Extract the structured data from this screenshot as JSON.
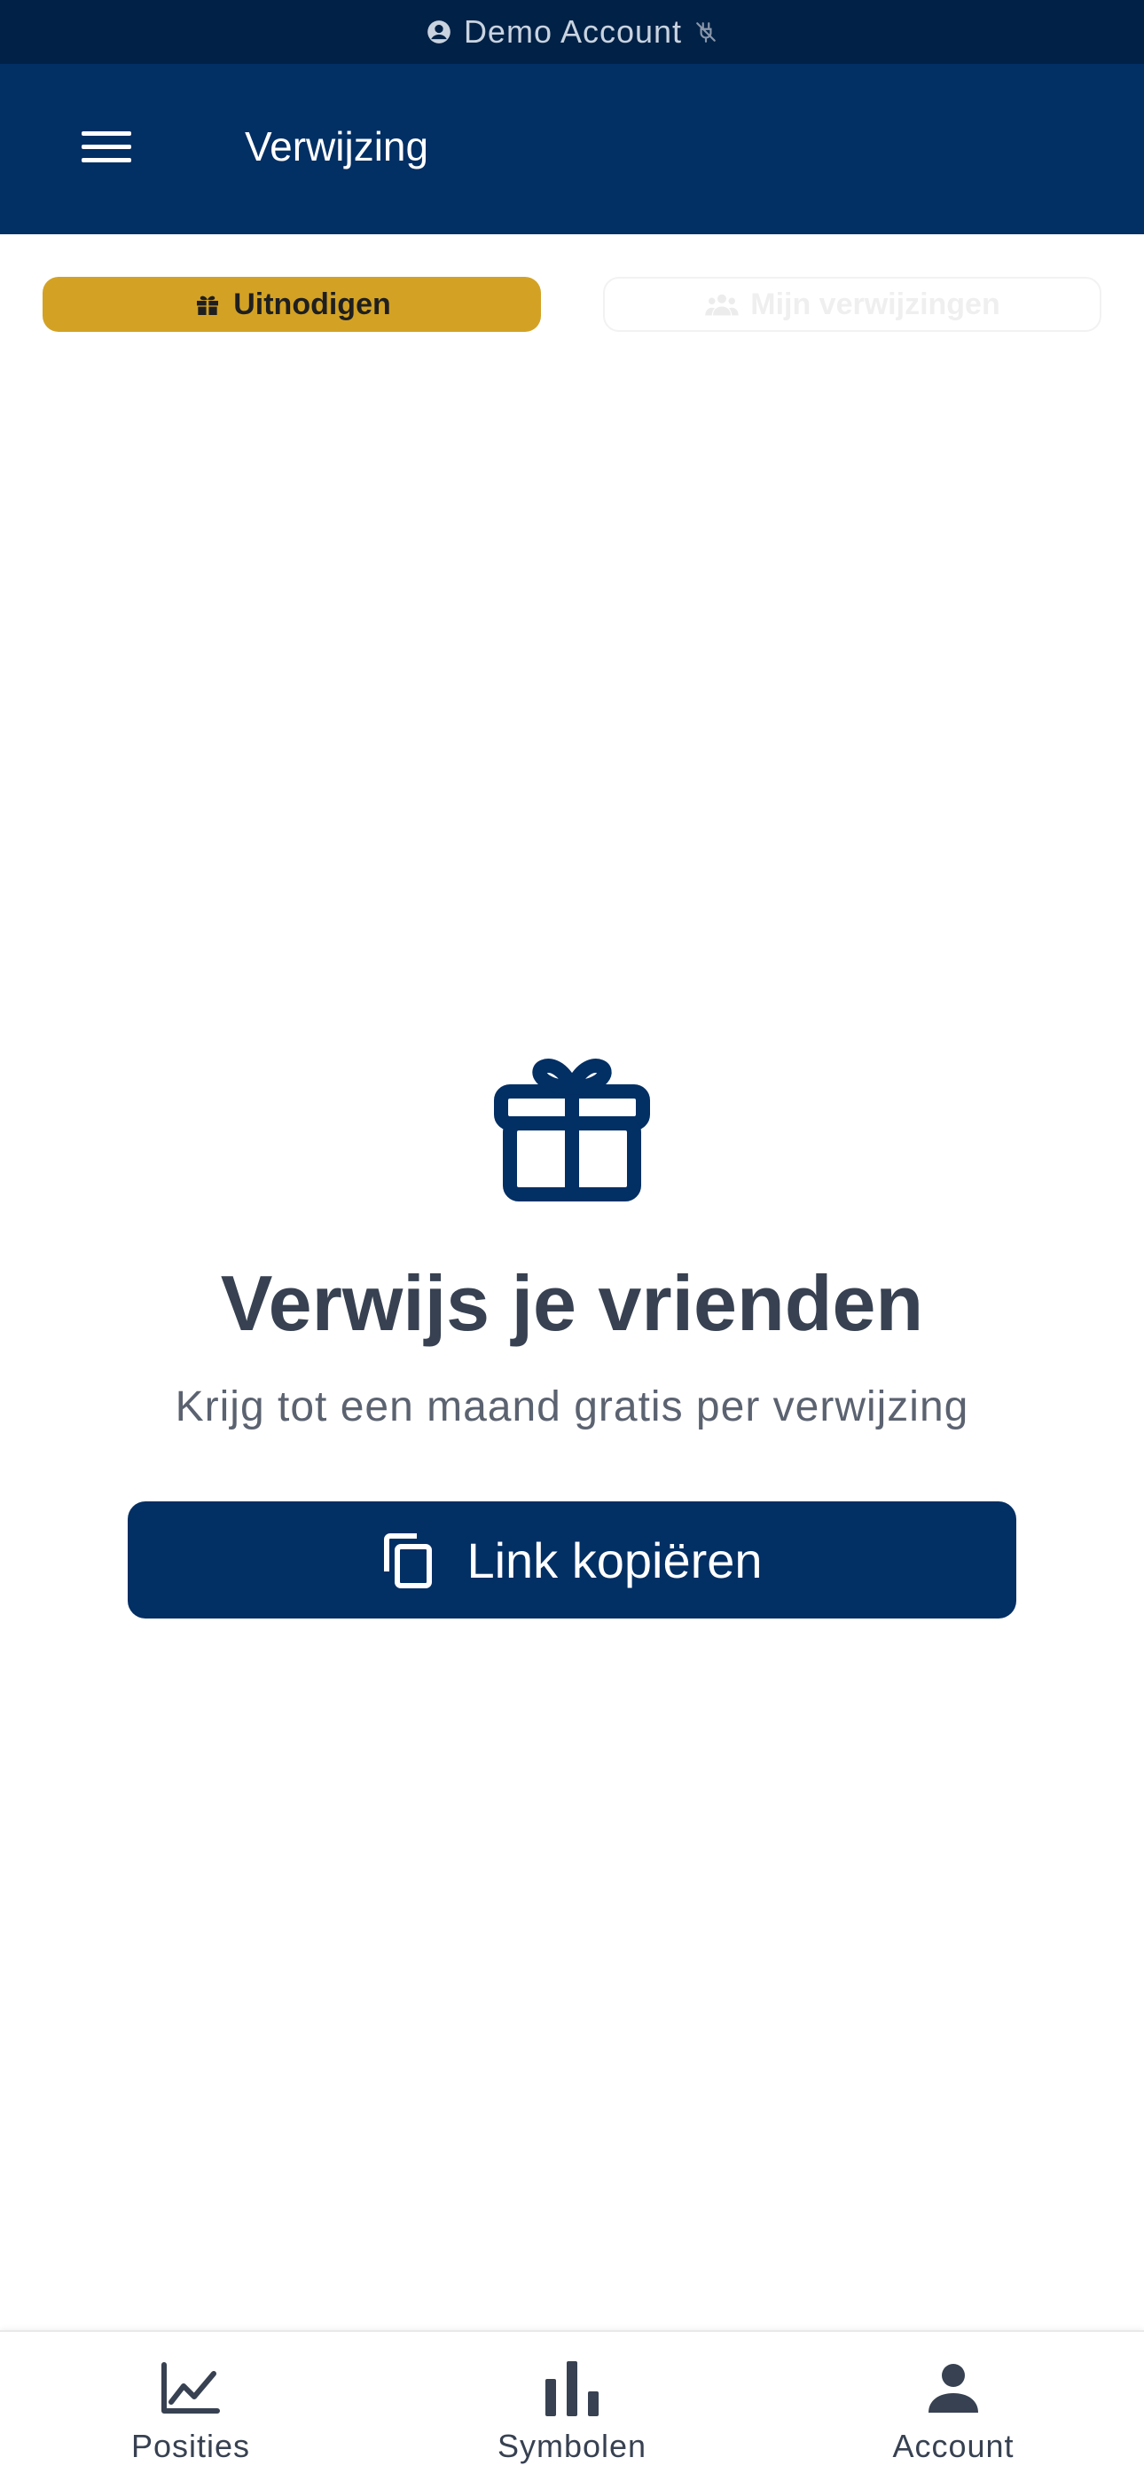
{
  "demo_banner": {
    "label": "Demo Account",
    "left_icon": "account-circle-icon",
    "right_icon": "connection-off-icon"
  },
  "app_bar": {
    "title": "Verwijzing",
    "menu_icon": "hamburger-menu-icon"
  },
  "tabs": [
    {
      "label": "Uitnodigen",
      "icon": "gift-icon",
      "active": true
    },
    {
      "label": "Mijn verwijzingen",
      "icon": "people-icon",
      "active": false
    }
  ],
  "main": {
    "hero_icon": "gift-icon",
    "headline": "Verwijs je vrienden",
    "subline": "Krijg tot een maand gratis per verwijzing",
    "copy_button": {
      "label": "Link kopiëren",
      "icon": "copy-icon"
    }
  },
  "bottom_nav": [
    {
      "label": "Posities",
      "icon": "line-chart-icon"
    },
    {
      "label": "Symbolen",
      "icon": "bar-chart-icon"
    },
    {
      "label": "Account",
      "icon": "person-icon"
    }
  ],
  "colors": {
    "banner_bg": "#012146",
    "app_bar_bg": "#022f64",
    "accent_gold": "#d3a225",
    "primary_navy": "#022f64",
    "text_dark": "#374151"
  }
}
